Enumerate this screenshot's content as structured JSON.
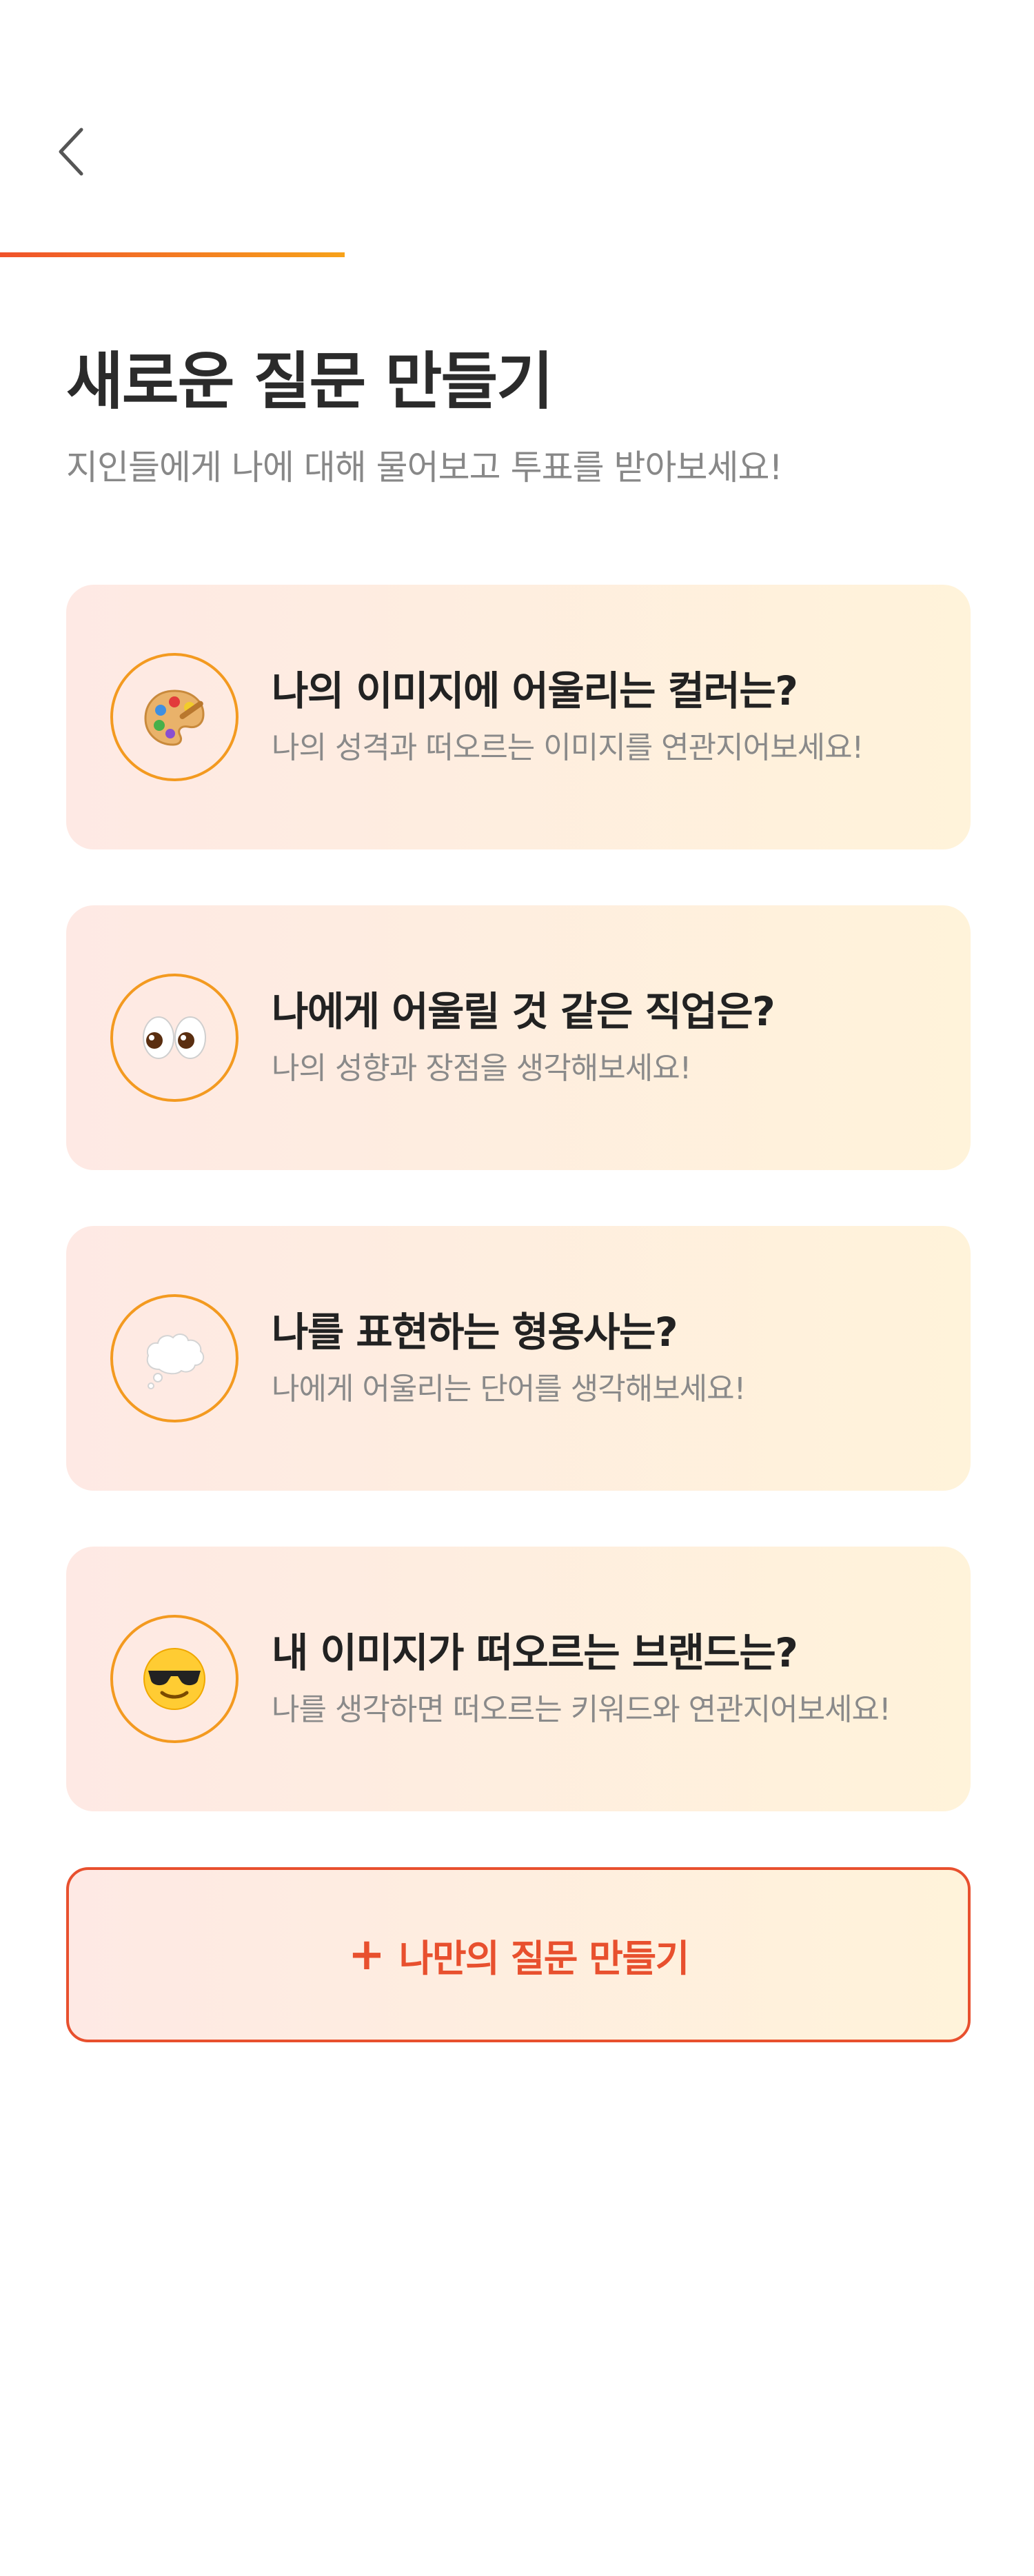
{
  "header": {
    "back_icon": "chevron-left-icon",
    "progress": 0.333
  },
  "page": {
    "title": "새로운 질문 만들기",
    "subtitle": "지인들에게 나에 대해 물어보고 투표를 받아보세요!"
  },
  "questions": [
    {
      "icon": "artist-palette-icon",
      "title": "나의 이미지에 어울리는 컬러는?",
      "description": "나의 성격과 떠오르는 이미지를 연관지어보세요!"
    },
    {
      "icon": "eyes-icon",
      "title": "나에게 어울릴 것 같은 직업은?",
      "description": "나의 성향과 장점을 생각해보세요!"
    },
    {
      "icon": "thought-balloon-icon",
      "title": "나를 표현하는 형용사는?",
      "description": "나에게 어울리는 단어를 생각해보세요!"
    },
    {
      "icon": "sunglasses-face-icon",
      "title": "내 이미지가 떠오르는 브랜드는?",
      "description": "나를 생각하면 떠오르는 키워드와 연관지어보세요!"
    }
  ],
  "custom_question": {
    "label": "나만의 질문 만들기",
    "icon": "plus-icon"
  },
  "colors": {
    "accent": "#e8502e",
    "progress_start": "#f0522a",
    "progress_end": "#f7a21a",
    "card_start": "#fee9e4",
    "card_end": "#fff3da",
    "ring": "#f39a20"
  }
}
